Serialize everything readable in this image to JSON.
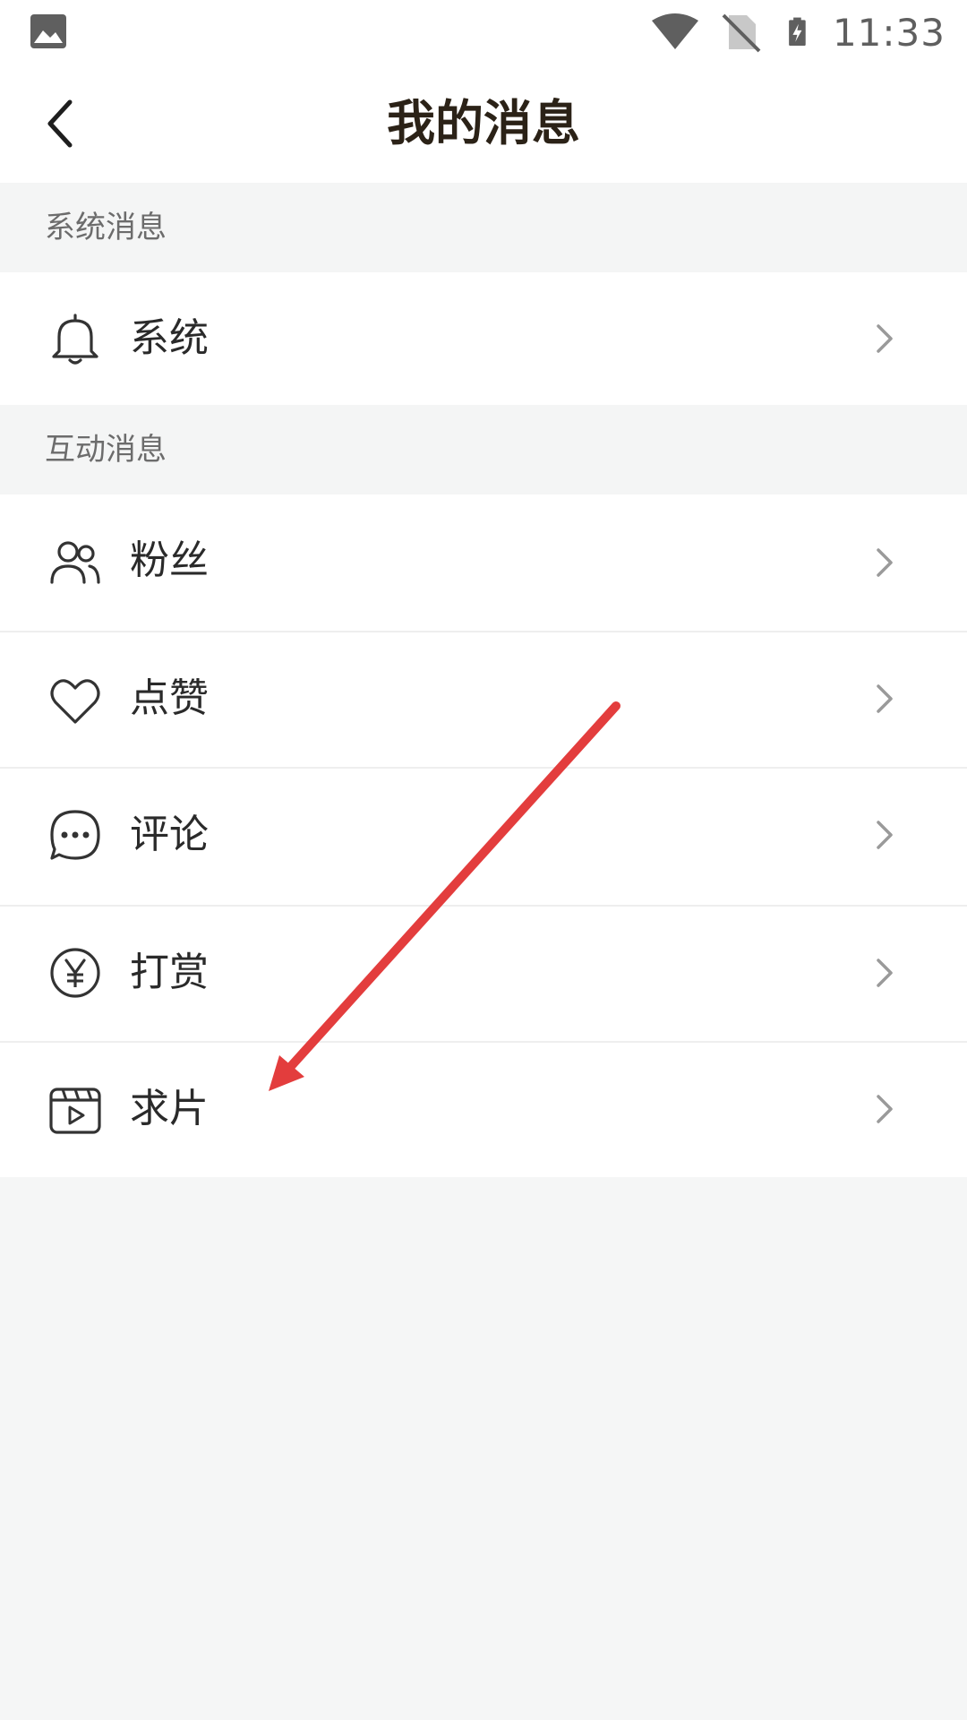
{
  "status_bar": {
    "time": "11:33",
    "icons": [
      "image-icon",
      "wifi-icon",
      "no-sim-icon",
      "battery-charging-icon"
    ]
  },
  "header": {
    "title": "我的消息",
    "back_icon": "chevron-left-icon"
  },
  "sections": [
    {
      "title": "系统消息",
      "items": [
        {
          "label": "系统",
          "icon": "bell-icon"
        }
      ]
    },
    {
      "title": "互动消息",
      "items": [
        {
          "label": "粉丝",
          "icon": "users-icon"
        },
        {
          "label": "点赞",
          "icon": "heart-icon"
        },
        {
          "label": "评论",
          "icon": "chat-bubble-icon"
        },
        {
          "label": "打赏",
          "icon": "yen-coin-icon"
        },
        {
          "label": "求片",
          "icon": "video-clapper-icon"
        }
      ]
    }
  ],
  "annotation": {
    "type": "arrow",
    "color": "#e33d3d"
  },
  "colors": {
    "background": "#f5f6f6",
    "surface": "#ffffff",
    "title_text": "#2b2217",
    "section_text": "#6c6c6c",
    "chevron": "#9a9a9a"
  }
}
